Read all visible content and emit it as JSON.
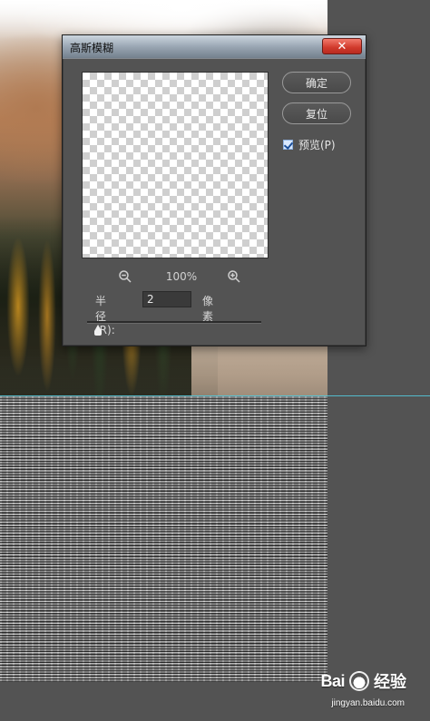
{
  "dialog": {
    "title": "高斯模糊",
    "close_glyph": "✕",
    "buttons": {
      "ok_label": "确定",
      "reset_label": "复位"
    },
    "preview_checkbox": {
      "label": "预览(P)",
      "checked": true
    },
    "zoom": {
      "value": "100%"
    },
    "radius": {
      "label": "半径(R):",
      "value": "2",
      "unit": "像素"
    },
    "slider": {
      "level_fraction": 0.06
    }
  },
  "watermark": {
    "brand": "Bai",
    "brand_suffix": "经验",
    "url": "jingyan.baidu.com"
  },
  "icons": {
    "zoom_out": "zoom-out-icon",
    "zoom_in": "zoom-in-icon",
    "close": "close-icon",
    "checkbox": "checkbox-icon",
    "paw": "paw-icon"
  },
  "colors": {
    "app_bg": "#535353",
    "dialog_bg": "#535353",
    "close_red": "#d0392b",
    "guide_cyan": "#53c7d8"
  }
}
